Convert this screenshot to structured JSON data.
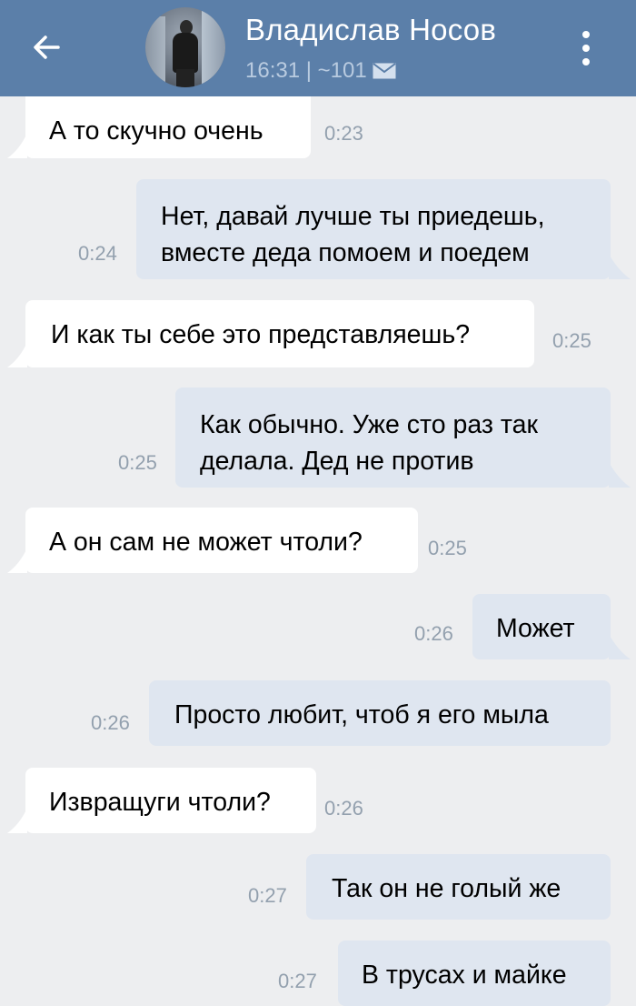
{
  "header": {
    "back_icon": "arrow-left-icon",
    "contact_name": "Владислав Носов",
    "status_text": "16:31 | ~101",
    "mail_icon": "envelope-icon",
    "menu_icon": "vertical-dots-icon",
    "colors": {
      "bar": "#5b7fa9",
      "status": "#b9cbe0"
    }
  },
  "colors": {
    "background": "#edeef0",
    "incoming_bubble": "#ffffff",
    "outgoing_bubble": "#dfe6f0",
    "timestamp": "#93a0ae"
  },
  "messages": [
    {
      "direction": "in",
      "text": "А то скучно очень",
      "time": "0:23"
    },
    {
      "direction": "out",
      "text": "Нет, давай лучше ты приедешь, вместе деда помоем и поедем",
      "time": "0:24"
    },
    {
      "direction": "in",
      "text": "И как ты себе это представляешь?",
      "time": "0:25"
    },
    {
      "direction": "out",
      "text": "Как обычно. Уже сто раз так делала. Дед не против",
      "time": "0:25"
    },
    {
      "direction": "in",
      "text": "А он сам не может чтоли?",
      "time": "0:25"
    },
    {
      "direction": "out",
      "text": "Может",
      "time": "0:26"
    },
    {
      "direction": "out",
      "text": "Просто любит, чтоб я его мыла",
      "time": "0:26"
    },
    {
      "direction": "in",
      "text": "Извращуги чтоли?",
      "time": "0:26"
    },
    {
      "direction": "out",
      "text": "Так он не голый же",
      "time": "0:27"
    },
    {
      "direction": "out",
      "text": "В трусах и майке",
      "time": "0:27"
    }
  ]
}
